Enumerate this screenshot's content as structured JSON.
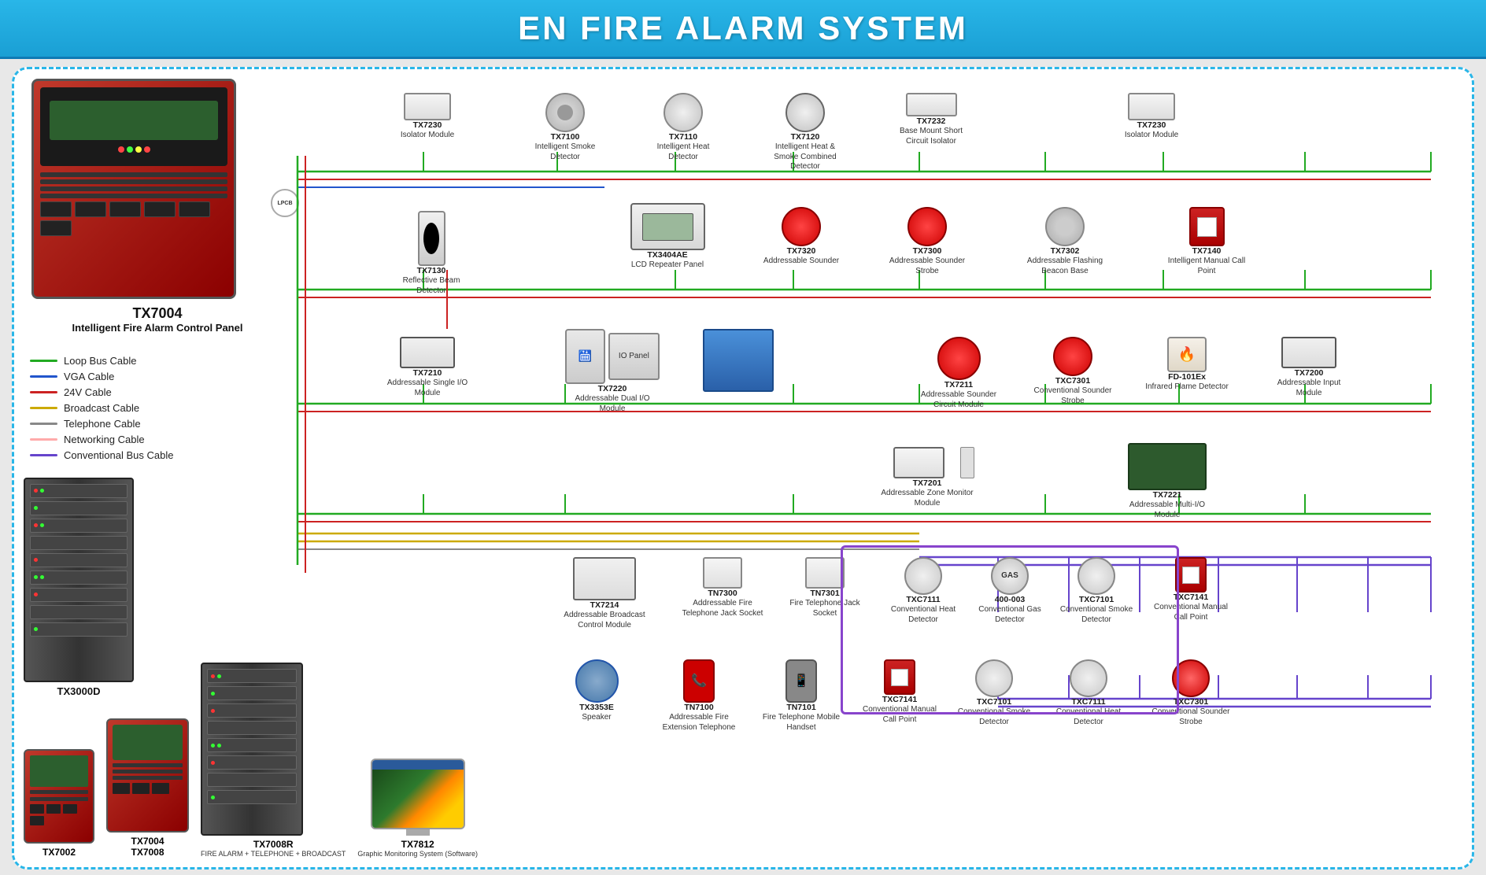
{
  "header": {
    "title": "EN FIRE ALARM SYSTEM"
  },
  "legend": {
    "items": [
      {
        "id": "loop-bus",
        "label": "Loop Bus Cable",
        "color": "#22aa22"
      },
      {
        "id": "vga",
        "label": "VGA Cable",
        "color": "#2255cc"
      },
      {
        "id": "24v",
        "label": "24V Cable",
        "color": "#cc2222"
      },
      {
        "id": "broadcast",
        "label": "Broadcast Cable",
        "color": "#ccaa00"
      },
      {
        "id": "telephone",
        "label": "Telephone Cable",
        "color": "#888888"
      },
      {
        "id": "networking",
        "label": "Networking Cable",
        "color": "#ffaaaa"
      },
      {
        "id": "conventional",
        "label": "Conventional Bus Cable",
        "color": "#6644cc"
      }
    ]
  },
  "main_panel": {
    "model": "TX7004",
    "description": "Intelligent Fire Alarm Control Panel"
  },
  "devices": {
    "tx7230_1": {
      "model": "TX7230",
      "desc": "Isolator Module"
    },
    "tx7100": {
      "model": "TX7100",
      "desc": "Intelligent Smoke Detector"
    },
    "tx7110": {
      "model": "TX7110",
      "desc": "Intelligent Heat Detector"
    },
    "tx7120": {
      "model": "TX7120",
      "desc": "Intelligent Heat & Smoke Combined Detector"
    },
    "tx7232": {
      "model": "TX7232",
      "desc": "Base Mount Short Circuit Isolator"
    },
    "tx7230_2": {
      "model": "TX7230",
      "desc": "Isolator Module"
    },
    "tx7130": {
      "model": "TX7130",
      "desc": "Reflective Beam Detector"
    },
    "tx3404ae": {
      "model": "TX3404AE",
      "desc": "LCD Repeater Panel"
    },
    "tx7320": {
      "model": "TX7320",
      "desc": "Addressable Sounder"
    },
    "tx7300": {
      "model": "TX7300",
      "desc": "Addressable Sounder Strobe"
    },
    "tx7302": {
      "model": "TX7302",
      "desc": "Addressable Flashing Beacon Base"
    },
    "tx7140": {
      "model": "TX7140",
      "desc": "Intelligent Manual Call Point"
    },
    "tx7210": {
      "model": "TX7210",
      "desc": "Addressable Single I/O Module"
    },
    "tx7220": {
      "model": "TX7220",
      "desc": "Addressable Dual I/O Module"
    },
    "tx7211": {
      "model": "TX7211",
      "desc": "Addressable Sounder Circuit Module"
    },
    "txc7301_1": {
      "model": "TXC7301",
      "desc": "Conventional Sounder Strobe"
    },
    "fd101ex": {
      "model": "FD-101Ex",
      "desc": "Infrared Flame Detector"
    },
    "tx7200": {
      "model": "TX7200",
      "desc": "Addressable Input Module"
    },
    "tx7201": {
      "model": "TX7201",
      "desc": "Addressable Zone Monitor Module"
    },
    "tx7221": {
      "model": "TX7221",
      "desc": "Addressable Multi-I/O Module"
    },
    "tx7214": {
      "model": "TX7214",
      "desc": "Addressable Broadcast Control Module"
    },
    "tn7300": {
      "model": "TN7300",
      "desc": "Addressable Fire Telephone Jack Socket"
    },
    "tn7301": {
      "model": "TN7301",
      "desc": "Fire Telephone Jack Socket"
    },
    "txc7111_1": {
      "model": "TXC7111",
      "desc": "Conventional Heat Detector"
    },
    "c400_003": {
      "model": "400-003",
      "desc": "Conventional Gas Detector"
    },
    "txc7101_1": {
      "model": "TXC7101",
      "desc": "Conventional Smoke Detector"
    },
    "txc7141_1": {
      "model": "TXC7141",
      "desc": "Conventional Manual Call Point"
    },
    "tx3353e": {
      "model": "TX3353E",
      "desc": "Speaker"
    },
    "tn7100": {
      "model": "TN7100",
      "desc": "Addressable Fire Extension Telephone"
    },
    "tn7101": {
      "model": "TN7101",
      "desc": "Fire Telephone Mobile Handset"
    },
    "txc7141_2": {
      "model": "TXC7141",
      "desc": "Conventional Manual Call Point"
    },
    "txc7101_2": {
      "model": "TXC7101",
      "desc": "Conventional Smoke Detector"
    },
    "txc7111_2": {
      "model": "TXC7111",
      "desc": "Conventional Heat Detector"
    },
    "txc7301_2": {
      "model": "TXC7301",
      "desc": "Conventional Sounder Strobe"
    },
    "tx3000d": {
      "model": "TX3000D",
      "desc": ""
    },
    "tx7002": {
      "model": "TX7002",
      "desc": ""
    },
    "tx7004_8": {
      "model": "TX7004\nTX7008",
      "desc": ""
    },
    "tx7008r": {
      "model": "TX7008R",
      "desc": "FIRE ALARM + TELEPHONE + BROADCAST"
    },
    "tx7812": {
      "model": "TX7812",
      "desc": "Graphic Monitoring System (Software)"
    }
  }
}
